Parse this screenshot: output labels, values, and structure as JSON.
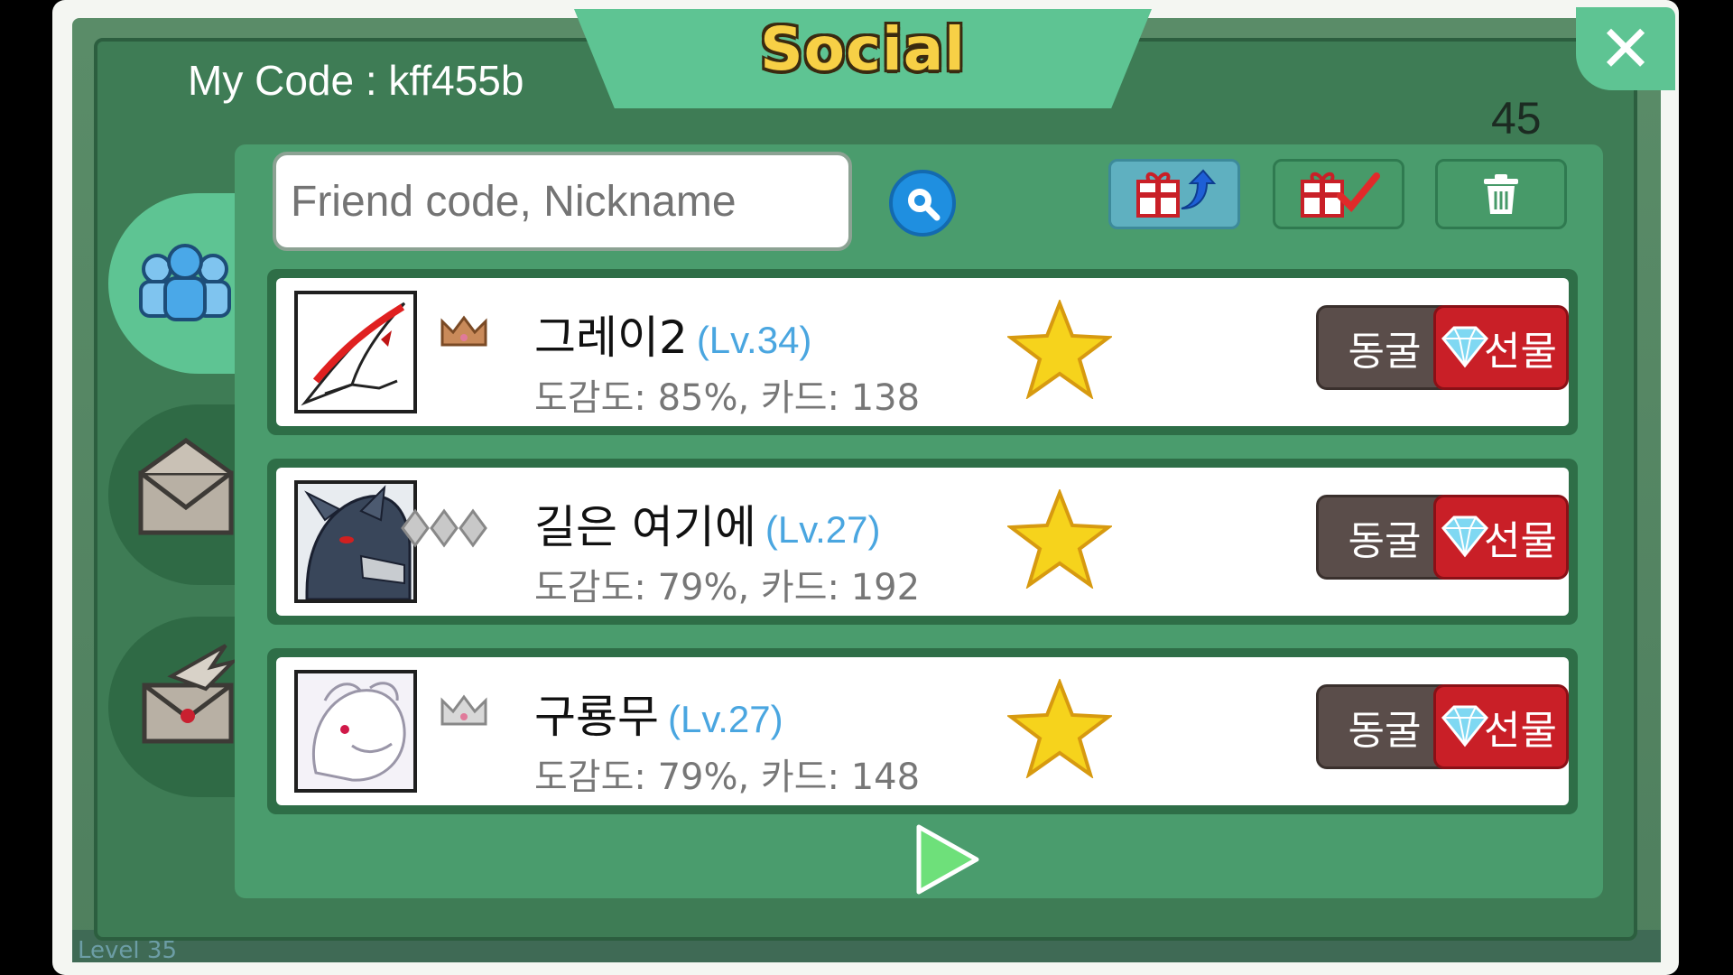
{
  "header": {
    "title": "Social",
    "my_code": "My Code : kff455b",
    "count": "45"
  },
  "search": {
    "placeholder": "Friend code, Nickname"
  },
  "toolbar": {
    "send_gifts_icon": "gift-send-icon",
    "receive_gifts_icon": "gift-check-icon",
    "delete_icon": "trash-icon"
  },
  "side_tabs": [
    {
      "icon": "friends-icon",
      "active": true
    },
    {
      "icon": "envelope-icon",
      "active": false
    },
    {
      "icon": "letter-wing-icon",
      "active": false
    }
  ],
  "friends": [
    {
      "name": "그레이2",
      "level": "(Lv.34)",
      "stats": "도감도: 85%, 카드: 138",
      "rank": "crown-bronze",
      "cave": "동굴",
      "gift": "선물"
    },
    {
      "name": "길은 여기에",
      "level": "(Lv.27)",
      "stats": "도감도: 79%, 카드: 192",
      "rank": "diamonds-silver",
      "cave": "동굴",
      "gift": "선물"
    },
    {
      "name": "구룡무",
      "level": "(Lv.27)",
      "stats": "도감도: 79%, 카드: 148",
      "rank": "crown-silver",
      "cave": "동굴",
      "gift": "선물"
    }
  ],
  "background": {
    "level_label": "Level 35"
  },
  "colors": {
    "panel": "#4a9c6d",
    "accent": "#5ec493",
    "gift": "#c91f27",
    "cave": "#5a4d4a",
    "level": "#4aa6e0"
  }
}
